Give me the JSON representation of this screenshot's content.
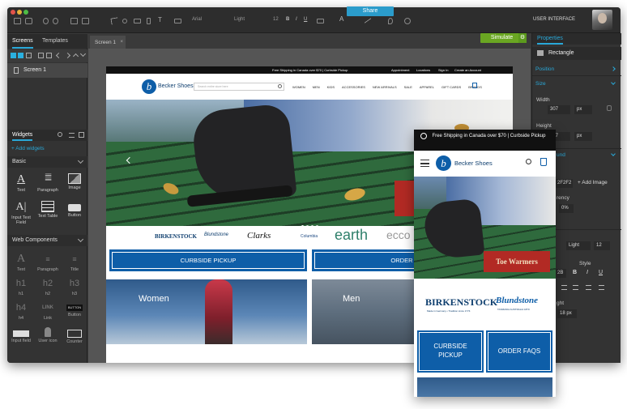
{
  "toolbar": {
    "font_family": "Arial",
    "font_weight": "Light",
    "font_size": "12",
    "workspace": "USER INTERFACE"
  },
  "left_panel": {
    "tabs": [
      "Screens",
      "Templates"
    ],
    "screens": [
      "Screen 1"
    ],
    "widgets_title": "Widgets",
    "add_widgets": "+ Add widgets",
    "basic_section": "Basic",
    "basic_widgets": [
      "Text",
      "Paragraph",
      "Image",
      "Input Text Field",
      "Text Table",
      "Button"
    ],
    "web_section": "Web Components",
    "web_widgets": [
      "Text",
      "Paragraph",
      "Title",
      "h1",
      "h2",
      "h3",
      "h4",
      "Link",
      "Button",
      "Input field",
      "User icon",
      "Counter"
    ],
    "heading_glyphs": [
      "h1",
      "h2",
      "h3",
      "h4"
    ],
    "link_glyph": "LINK",
    "button_glyph": "BUTTON"
  },
  "canvas": {
    "tab_label": "Screen 1",
    "share_label": "Share",
    "simulate_label": "Simulate"
  },
  "site": {
    "topbar": "Free Shipping in Canada over $70 | Curbside Pickup",
    "topbar_links": [
      "Appointment",
      "Locations",
      "Sign In",
      "Create an Account"
    ],
    "brand": "Becker Shoes",
    "search_placeholder": "Search entire store here",
    "nav": [
      "WOMEN",
      "MEN",
      "KIDS",
      "ACCESSORIES",
      "NEW ARRIVALS",
      "SALE",
      "APPAREL",
      "GIFT CARDS",
      "BRANDS"
    ],
    "brands": [
      "BIRKENSTOCK",
      "Blundstone",
      "Clarks",
      "Columbia",
      "earth",
      "ecco"
    ],
    "curbside": "CURBSIDE PICKUP",
    "order_faqs": "ORDER FAQS",
    "tile_women": "Women",
    "tile_men": "Men"
  },
  "phone": {
    "topbar": "Free Shipping in Canada over $70 | Curbside Pickup",
    "brand": "Becker Shoes",
    "brand_birk": "BIRKENSTOCK",
    "brand_birk_sub": "Made in Germany • Tradition since 1774",
    "brand_blund": "Blundstone",
    "brand_blund_sub": "TASMANIA AUSTRALIA 1870",
    "curbside": "CURBSIDE PICKUP",
    "order_faqs": "ORDER FAQS",
    "sale_banner": "Toe Warmers"
  },
  "properties": {
    "title": "Properties",
    "element": "Rectangle",
    "position": "Position",
    "size": "Size",
    "width_label": "Width",
    "width_value": "307",
    "height_label": "Height",
    "height_value": "307",
    "unit": "px",
    "background_fragment": "und",
    "color_fragment": "2F2F2",
    "add_image": "+ Add Image",
    "transparency_fragment": "rency",
    "transparency_value": "0%",
    "font_weight": "Light",
    "font_size": "12",
    "style_label": "Style",
    "line_fragment": "ght",
    "line_value": "18",
    "line_unit": "px",
    "misc_fragment": "2B"
  },
  "colors": {
    "accent": "#29a8d8",
    "share": "#2b9ccb",
    "simulate": "#6aa622",
    "site_blue": "#0e5ea8"
  }
}
